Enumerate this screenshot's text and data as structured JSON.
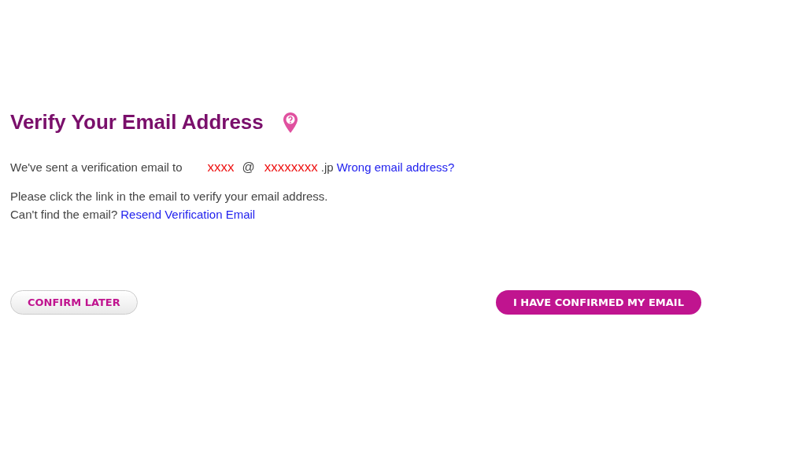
{
  "title": "Verify Your Email Address",
  "sent_line": {
    "text": "We've sent a verification email to",
    "email_user": "xxxx",
    "at": "@",
    "email_domain": "xxxxxxxx",
    "email_tld": ".jp",
    "link": "Wrong email address?"
  },
  "instruction": "Please click the link in the email to verify your email address.",
  "resend_line": {
    "text": "Can't find the email?",
    "link": "Resend Verification Email"
  },
  "buttons": [
    {
      "label": "CONFIRM LATER",
      "kind": "secondary"
    },
    {
      "label": "I HAVE CONFIRMED MY EMAIL",
      "kind": "primary"
    }
  ]
}
